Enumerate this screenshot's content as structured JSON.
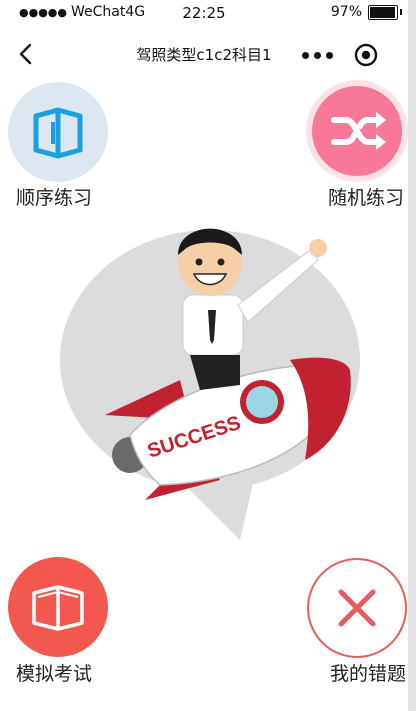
{
  "status_bar": {
    "signal_dots": "●●●●●",
    "carrier": "WeChat4G",
    "time": "22:25",
    "battery_percent": "97%",
    "battery_level": 0.97
  },
  "nav": {
    "title": "驾照类型c1c2科目1"
  },
  "actions": {
    "order_practice": "顺序练习",
    "random_practice": "随机练习",
    "mock_exam": "模拟考试",
    "my_mistakes": "我的错题"
  },
  "illustration": {
    "rocket_text": "SUCCESS"
  },
  "colors": {
    "order_bg": "#dce7f1",
    "order_icon": "#1aa0e0",
    "random_bg": "#f77899",
    "exam_bg": "#f2584d",
    "mistakes_accent": "#ea5b5b",
    "rocket_red": "#c2222f"
  },
  "icons": {
    "order": "open-book-icon",
    "random": "shuffle-icon",
    "exam": "book-icon",
    "mistakes": "close-x-icon"
  }
}
